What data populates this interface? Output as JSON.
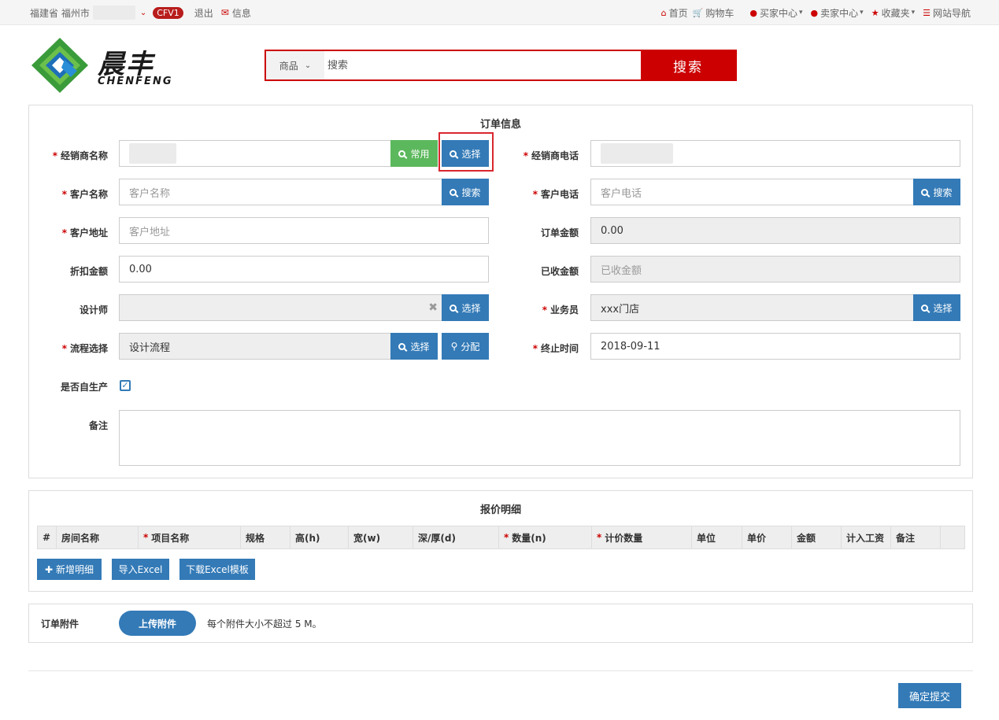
{
  "topbar": {
    "region": "福建省 福州市",
    "badge": "CFV1",
    "logout": "退出",
    "message": "信息",
    "nav": [
      {
        "label": "首页",
        "icon": "home-icon"
      },
      {
        "label": "购物车",
        "icon": "cart-icon"
      },
      {
        "label": "买家中心",
        "icon": "user-icon",
        "dropdown": true
      },
      {
        "label": "卖家中心",
        "icon": "user-icon",
        "dropdown": true
      },
      {
        "label": "收藏夹",
        "icon": "star-icon",
        "dropdown": true
      },
      {
        "label": "网站导航",
        "icon": "list-icon"
      }
    ]
  },
  "logo": {
    "cn": "晨丰",
    "en": "CHENFENG"
  },
  "search": {
    "category": "商品",
    "placeholder": "搜索",
    "button": "搜索"
  },
  "order": {
    "title": "订单信息",
    "dealer_name": {
      "label": "经销商名称",
      "btn_common": "常用",
      "btn_select": "选择"
    },
    "dealer_phone": {
      "label": "经销商电话"
    },
    "customer_name": {
      "label": "客户名称",
      "placeholder": "客户名称",
      "btn": "搜索"
    },
    "customer_phone": {
      "label": "客户电话",
      "placeholder": "客户电话",
      "btn": "搜索"
    },
    "customer_address": {
      "label": "客户地址",
      "placeholder": "客户地址"
    },
    "order_amount": {
      "label": "订单金额",
      "value": "0.00"
    },
    "discount_amount": {
      "label": "折扣金额",
      "value": "0.00"
    },
    "received_amount": {
      "label": "已收金额",
      "placeholder": "已收金额"
    },
    "designer": {
      "label": "设计师",
      "btn": "选择"
    },
    "salesman": {
      "label": "业务员",
      "value": "xxx门店",
      "btn": "选择"
    },
    "process": {
      "label": "流程选择",
      "value": "设计流程",
      "btn_select": "选择",
      "btn_assign": "分配"
    },
    "end_date": {
      "label": "终止时间",
      "value": "2018-09-11"
    },
    "self_production": {
      "label": "是否自生产",
      "checked": true
    },
    "remark": {
      "label": "备注"
    }
  },
  "quote": {
    "title": "报价明细",
    "columns": [
      "#",
      "房间名称",
      "项目名称",
      "规格",
      "高(h)",
      "宽(w)",
      "深/厚(d)",
      "数量(n)",
      "计价数量",
      "单位",
      "单价",
      "金额",
      "计入工资",
      "备注"
    ],
    "buttons": {
      "add": "新增明细",
      "import": "导入Excel",
      "download": "下载Excel模板"
    }
  },
  "attachment": {
    "label": "订单附件",
    "upload": "上传附件",
    "note": "每个附件大小不超过 5 M。"
  },
  "submit": "确定提交",
  "colors": {
    "brand_red": "#cc0000",
    "primary_blue": "#337ab7",
    "success_green": "#5cb85c"
  }
}
